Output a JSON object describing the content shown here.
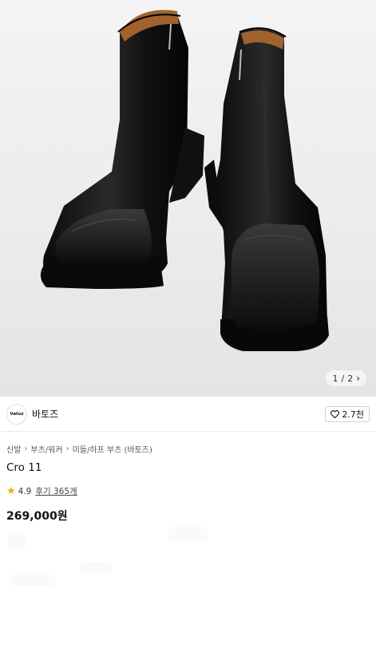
{
  "hero": {
    "image_name": "product-image-black-square-toe-boots",
    "pager": {
      "current": "1",
      "separator": "/",
      "total": "2",
      "arrow": "›"
    }
  },
  "brand": {
    "logo_text": "Vatoz",
    "name": "바토즈",
    "like_count": "2.7천"
  },
  "breadcrumb": [
    "신발",
    "부츠/워커",
    "미들/하프 부츠 (바토즈)"
  ],
  "product": {
    "name": "Cro 11",
    "rating": "4.9",
    "review_label": "후기 365개",
    "price": "269,000원"
  },
  "colors": {
    "star": "#f2a900",
    "boot": "#151515",
    "lining": "#a0622e"
  }
}
